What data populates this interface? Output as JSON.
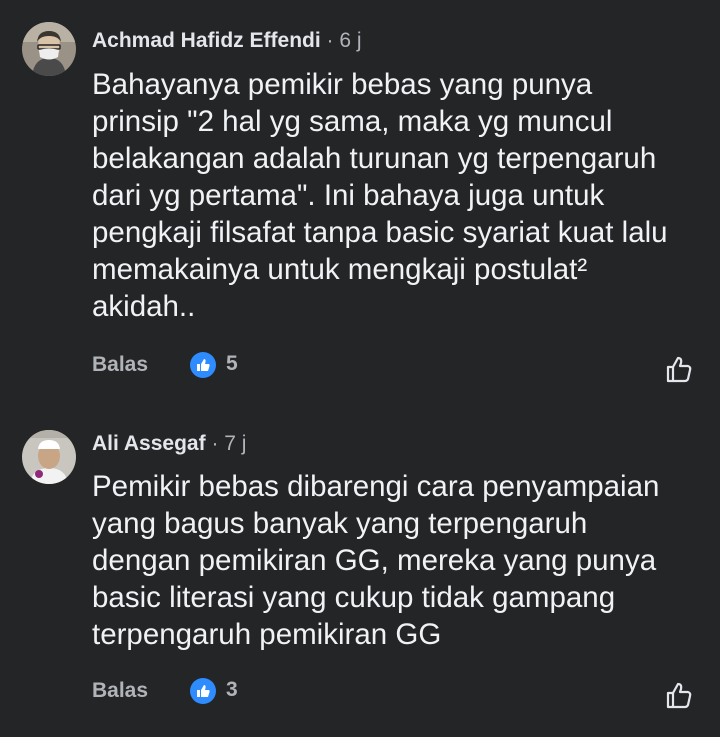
{
  "comments": [
    {
      "author": "Achmad Hafidz Effendi",
      "separator": "·",
      "time": "6 j",
      "avatar_icon": "avatar-man-with-mask",
      "body_lines": [
        "Bahayanya pemikir bebas yang punya",
        "prinsip \"2 hal yg sama, maka yg muncul",
        "belakangan adalah turunan yg terpengaruh",
        "dari yg pertama\". Ini bahaya juga untuk",
        "pengkaji filsafat tanpa basic syariat kuat lalu",
        "memakainya untuk mengkaji postulat²",
        "akidah.."
      ],
      "reply_label": "Balas",
      "like_count": "5"
    },
    {
      "author": "Ali Assegaf",
      "separator": "·",
      "time": "7 j",
      "avatar_icon": "avatar-man-with-cap",
      "body_lines": [
        "Pemikir bebas dibarengi cara penyampaian",
        "yang bagus banyak yang terpengaruh",
        "dengan pemikiran GG, mereka yang punya",
        "basic literasi yang cukup tidak gampang",
        "terpengaruh pemikiran GG"
      ],
      "reply_label": "Balas",
      "like_count": "3"
    }
  ],
  "colors": {
    "background": "#242526",
    "text_primary": "#f0f2f5",
    "text_secondary": "#b0b3b8",
    "like_badge": "#2e8cff"
  }
}
